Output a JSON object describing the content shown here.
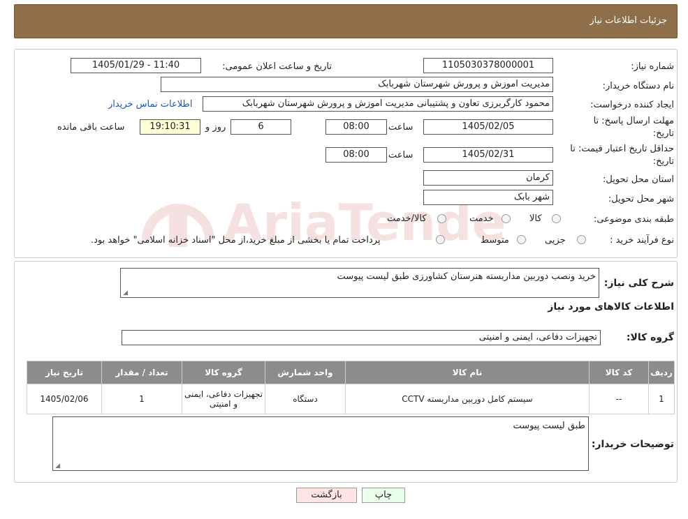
{
  "header": {
    "title": "جزئیات اطلاعات نیاز"
  },
  "form": {
    "need_number_label": "شماره نیاز:",
    "need_number": "1105030378000001",
    "announce_label": "تاریخ و ساعت اعلان عمومی:",
    "announce_value": "1405/01/29 - 11:40",
    "buyer_org_label": "نام دستگاه خریدار:",
    "buyer_org": "مدیریت اموزش و پرورش شهرستان شهربابک",
    "requester_label": "ایجاد کننده درخواست:",
    "requester": "محمود کارگربرزی تعاون و پشتیبانی مدیریت اموزش و پرورش شهرستان شهربابک",
    "contact_link": "اطلاعات تماس خریدار",
    "deadline_label_1": "مهلت ارسال پاسخ: تا",
    "deadline_label_2": "تاریخ:",
    "deadline_date": "1405/02/05",
    "time_label": "ساعت",
    "deadline_time": "08:00",
    "days": "6",
    "days_label": "روز و",
    "remaining_time": "19:10:31",
    "remaining_label": "ساعت باقی مانده",
    "validity_label_1": "حداقل تاریخ اعتبار قیمت: تا",
    "validity_label_2": "تاریخ:",
    "validity_date": "1405/02/31",
    "validity_time": "08:00",
    "province_label": "استان محل تحویل:",
    "province": "کرمان",
    "city_label": "شهر محل تحویل:",
    "city": "شهر بابک",
    "category_label": "طبقه بندی موضوعی:",
    "category_options": [
      "کالا",
      "خدمت",
      "کالا/خدمت"
    ],
    "purchase_type_label": "نوع فرآیند خرید :",
    "purchase_options": [
      "جزیی",
      "متوسط"
    ],
    "purchase_note": "پرداخت تمام یا بخشی از مبلغ خرید،از محل \"اسناد خزانه اسلامی\" خواهد بود."
  },
  "summary": {
    "label": "شرح کلی نیاز:",
    "text": "خرید ونصب دوربین مداربسته هنرستان کشاورزی  طبق لیست پیوست",
    "goods_info_title": "اطلاعات کالاهای مورد نیاز",
    "goods_group_label": "گروه کالا:",
    "goods_group": "تجهیزات دفاعی، ایمنی و امنیتی"
  },
  "table": {
    "headers": [
      "ردیف",
      "کد کالا",
      "نام کالا",
      "واحد شمارش",
      "گروه کالا",
      "تعداد / مقدار",
      "تاریخ نیاز"
    ],
    "rows": [
      [
        "1",
        "--",
        "سیستم کامل دوربین مداربسته CCTV",
        "دستگاه",
        "تجهیزات دفاعی، ایمنی و امنیتی",
        "1",
        "1405/02/06"
      ]
    ]
  },
  "buyer_notes": {
    "label": "توضیحات خریدار:",
    "text": "طبق لیست پیوست"
  },
  "buttons": {
    "print": "چاپ",
    "back": "بازگشت"
  },
  "watermark": {
    "text": "AriaTender.neT"
  },
  "colors": {
    "header_bg": "#8f6f4a",
    "table_header_bg": "#8c8c8c",
    "link": "#1a55b8",
    "remaining_bg": "#ffffd6",
    "print_bg": "#eaffea",
    "back_bg": "#ffe4e4"
  }
}
